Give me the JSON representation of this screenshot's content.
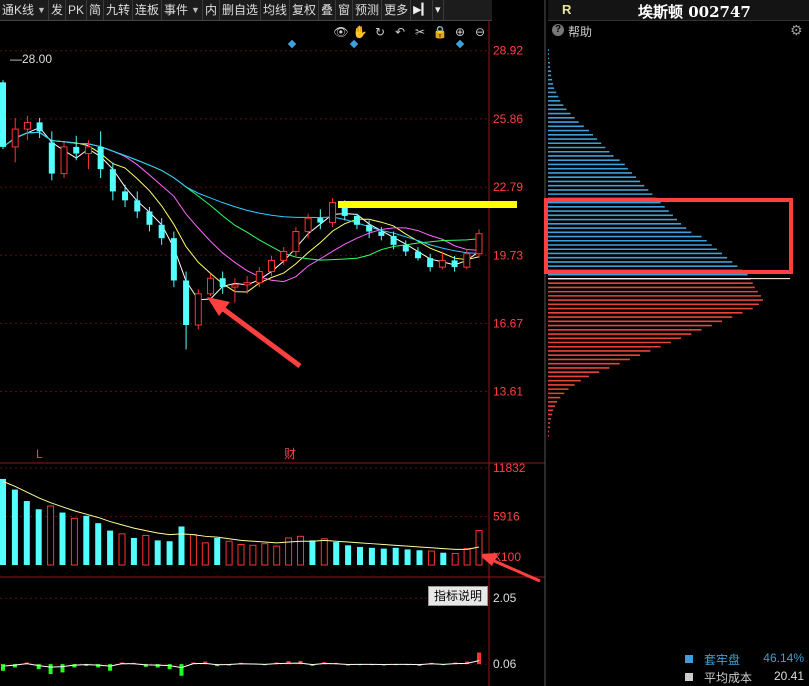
{
  "toolbar": {
    "items": [
      {
        "label": "通K线",
        "dropdown": true
      },
      {
        "label": "发",
        "dropdown": false
      },
      {
        "label": "PK",
        "dropdown": false
      },
      {
        "label": "简",
        "dropdown": false
      },
      {
        "label": "九转",
        "dropdown": false
      },
      {
        "label": "连板",
        "dropdown": false
      },
      {
        "label": "事件",
        "dropdown": true
      },
      {
        "label": "内",
        "dropdown": false
      },
      {
        "label": "删自选",
        "dropdown": false
      },
      {
        "label": "均线",
        "dropdown": false
      },
      {
        "label": "复权",
        "dropdown": false
      },
      {
        "label": "叠",
        "dropdown": false
      },
      {
        "label": "窗",
        "dropdown": false
      },
      {
        "label": "预测",
        "dropdown": false
      },
      {
        "label": "更多",
        "dropdown": false
      }
    ],
    "nav_icon": "play-next-icon",
    "menu_icon": "caret-down-icon"
  },
  "chart_icons": [
    "eye-icon",
    "hand-icon",
    "cycle-icon",
    "undo-icon",
    "scissors-icon",
    "lock-icon",
    "zoom-in-icon",
    "zoom-out-icon"
  ],
  "stock": {
    "badge": "R",
    "name": "埃斯顿 002747"
  },
  "help": {
    "label": "帮助",
    "icon": "help-icon"
  },
  "indicator_button": "指标说明",
  "markers": {
    "left_label": "L",
    "finance_label": "财",
    "high_label": "28.00"
  },
  "colors": {
    "up": "#ff3333",
    "down": "#54ffff",
    "volume_line": "#ffff99",
    "highlight_bar": "#ffff00",
    "annotation": "#ff4040",
    "dist_down": "#3f9fd8",
    "dist_up": "#e8443a"
  },
  "summary": {
    "locked": {
      "label": "套牢盘",
      "value": "46.14%",
      "color": "#3f9fd8"
    },
    "avg_cost": {
      "label": "平均成本",
      "value": "20.41",
      "color": "#cccccc"
    }
  },
  "chart_data": [
    {
      "type": "candlestick",
      "title": "",
      "yaxis_ticks": [
        28.92,
        25.86,
        22.79,
        19.73,
        16.67,
        13.61
      ],
      "ylim": [
        10.4,
        30.3
      ],
      "ma_lines": [
        "white",
        "yellow",
        "magenta",
        "green",
        "cyan"
      ],
      "candles": [
        [
          27.5,
          27.6,
          24.5,
          24.6
        ],
        [
          24.6,
          25.9,
          23.9,
          25.4
        ],
        [
          25.4,
          26.0,
          24.9,
          25.7
        ],
        [
          25.7,
          25.9,
          25.0,
          25.3
        ],
        [
          24.8,
          25.3,
          23.1,
          23.4
        ],
        [
          23.4,
          24.8,
          23.2,
          24.6
        ],
        [
          24.6,
          25.1,
          24.0,
          24.3
        ],
        [
          24.3,
          24.9,
          23.6,
          24.6
        ],
        [
          24.6,
          25.3,
          23.2,
          23.6
        ],
        [
          23.6,
          23.9,
          22.2,
          22.6
        ],
        [
          22.6,
          22.9,
          21.9,
          22.2
        ],
        [
          22.2,
          22.6,
          21.4,
          21.7
        ],
        [
          21.7,
          21.9,
          20.8,
          21.1
        ],
        [
          21.1,
          21.4,
          20.2,
          20.5
        ],
        [
          20.5,
          20.8,
          18.3,
          18.6
        ],
        [
          18.6,
          19.0,
          15.5,
          16.6
        ],
        [
          16.6,
          18.2,
          16.4,
          18.0
        ],
        [
          18.0,
          18.9,
          17.9,
          18.7
        ],
        [
          18.7,
          19.0,
          18.0,
          18.3
        ],
        [
          18.3,
          18.7,
          17.6,
          18.4
        ],
        [
          18.4,
          18.8,
          18.0,
          18.5
        ],
        [
          18.5,
          19.2,
          18.3,
          19.0
        ],
        [
          19.0,
          19.7,
          18.8,
          19.5
        ],
        [
          19.5,
          20.1,
          19.3,
          19.9
        ],
        [
          19.9,
          21.0,
          19.7,
          20.8
        ],
        [
          20.8,
          21.6,
          20.5,
          21.4
        ],
        [
          21.4,
          21.8,
          20.9,
          21.2
        ],
        [
          21.2,
          22.3,
          21.0,
          22.1
        ],
        [
          22.1,
          22.2,
          21.3,
          21.5
        ],
        [
          21.5,
          21.6,
          20.9,
          21.1
        ],
        [
          21.1,
          21.3,
          20.5,
          20.8
        ],
        [
          20.8,
          21.0,
          20.4,
          20.6
        ],
        [
          20.6,
          20.8,
          20.0,
          20.2
        ],
        [
          20.2,
          20.4,
          19.7,
          19.9
        ],
        [
          19.9,
          20.1,
          19.5,
          19.6
        ],
        [
          19.6,
          19.8,
          19.0,
          19.2
        ],
        [
          19.2,
          19.9,
          19.1,
          19.5
        ],
        [
          19.5,
          19.7,
          19.0,
          19.2
        ],
        [
          19.2,
          20.0,
          19.1,
          19.8
        ],
        [
          19.8,
          20.9,
          19.6,
          20.7
        ]
      ]
    },
    {
      "type": "bar",
      "title": "volume",
      "unit_label": "X100",
      "yaxis_ticks": [
        11832,
        5916
      ],
      "ylim": [
        0,
        12200
      ],
      "values": [
        10500,
        9200,
        7800,
        6800,
        7200,
        6400,
        5700,
        6000,
        5100,
        4200,
        3800,
        3300,
        3600,
        3000,
        2900,
        4700,
        3700,
        2700,
        3300,
        2900,
        2500,
        2400,
        2600,
        2300,
        3300,
        3500,
        3000,
        3200,
        2800,
        2400,
        2200,
        2100,
        2000,
        2100,
        1900,
        1800,
        1700,
        1500,
        1400,
        2000,
        4200
      ],
      "up": [
        0,
        0,
        0,
        0,
        1,
        0,
        1,
        0,
        0,
        0,
        1,
        0,
        1,
        0,
        0,
        0,
        1,
        1,
        0,
        1,
        1,
        1,
        1,
        1,
        1,
        1,
        0,
        1,
        0,
        0,
        0,
        0,
        0,
        0,
        0,
        0,
        1,
        0,
        1,
        1,
        1
      ],
      "avg_line": [
        10200,
        9600,
        8900,
        8200,
        7600,
        7100,
        6600,
        6200,
        5800,
        5300,
        4900,
        4500,
        4200,
        3900,
        3700,
        3800,
        3700,
        3500,
        3400,
        3200,
        3000,
        2900,
        2800,
        2700,
        2800,
        2900,
        2900,
        3000,
        2900,
        2800,
        2700,
        2600,
        2500,
        2400,
        2300,
        2200,
        2100,
        2000,
        1900,
        1900,
        2200
      ]
    },
    {
      "type": "bar",
      "title": "indicator",
      "yaxis_ticks": [
        2.05,
        0.06
      ],
      "ylim": [
        -0.6,
        2.6
      ],
      "values": [
        -0.2,
        -0.1,
        0.05,
        -0.15,
        -0.3,
        -0.25,
        -0.1,
        -0.05,
        -0.1,
        -0.2,
        0.05,
        0.04,
        -0.08,
        -0.1,
        -0.15,
        -0.35,
        0.05,
        0.08,
        -0.06,
        -0.04,
        0.04,
        0.02,
        -0.03,
        0.05,
        0.09,
        0.1,
        -0.05,
        0.06,
        0.04,
        -0.04,
        -0.02,
        -0.03,
        -0.04,
        -0.02,
        -0.03,
        -0.05,
        0.04,
        -0.02,
        0.05,
        0.08,
        0.35
      ]
    },
    {
      "type": "histogram",
      "title": "chip distribution",
      "price_range": [
        14.0,
        28.5
      ],
      "current_price": 20.0,
      "values": [
        1,
        1,
        1,
        2,
        2,
        3,
        3,
        4,
        5,
        6,
        8,
        10,
        12,
        15,
        18,
        22,
        26,
        30,
        35,
        40,
        44,
        48,
        52,
        56,
        60,
        64,
        70,
        75,
        78,
        82,
        86,
        90,
        94,
        98,
        102,
        106,
        110,
        114,
        118,
        122,
        126,
        130,
        135,
        140,
        150,
        155,
        160,
        165,
        170,
        175,
        180,
        185,
        190,
        195,
        198,
        200,
        202,
        205,
        208,
        210,
        206,
        200,
        190,
        180,
        170,
        160,
        150,
        140,
        130,
        120,
        110,
        100,
        90,
        80,
        70,
        60,
        50,
        40,
        32,
        26,
        20,
        16,
        12,
        9,
        7,
        5,
        4,
        3,
        2,
        2,
        1,
        1
      ]
    }
  ]
}
